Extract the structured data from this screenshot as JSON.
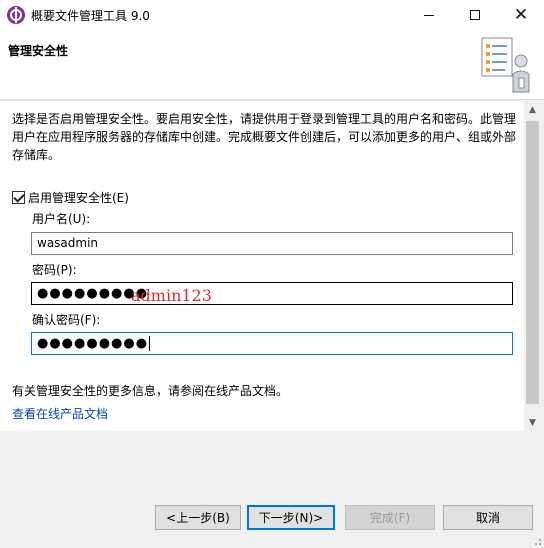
{
  "window": {
    "title": "概要文件管理工具 9.0",
    "controls": {
      "minimize": "minimize",
      "maximize": "maximize",
      "close": "✕"
    }
  },
  "header": {
    "title": "管理安全性"
  },
  "main": {
    "description": "选择是否启用管理安全性。要启用安全性，请提供用于登录到管理工具的用户名和密码。此管理用户在应用程序服务器的存储库中创建。完成概要文件创建后，可以添加更多的用户、组或外部存储库。",
    "enable_security": {
      "label": "启用管理安全性(E)",
      "checked": true
    },
    "username": {
      "label": "用户名(U):",
      "value": "wasadmin"
    },
    "password": {
      "label": "密码(P):",
      "masked": "●●●●●●●●●"
    },
    "confirm_password": {
      "label": "确认密码(F):",
      "masked": "●●●●●●●●●"
    },
    "annotation": "admin123",
    "info_text": "有关管理安全性的更多信息，请参阅在线产品文档。",
    "link_text": "查看在线产品文档"
  },
  "buttons": {
    "back": "<上一步(B)",
    "next": "下一步(N)>",
    "finish": "完成(F)",
    "cancel": "取消"
  },
  "colors": {
    "link": "#0645ad",
    "annotation": "#e02a2a",
    "focus_border": "#0078d7"
  }
}
